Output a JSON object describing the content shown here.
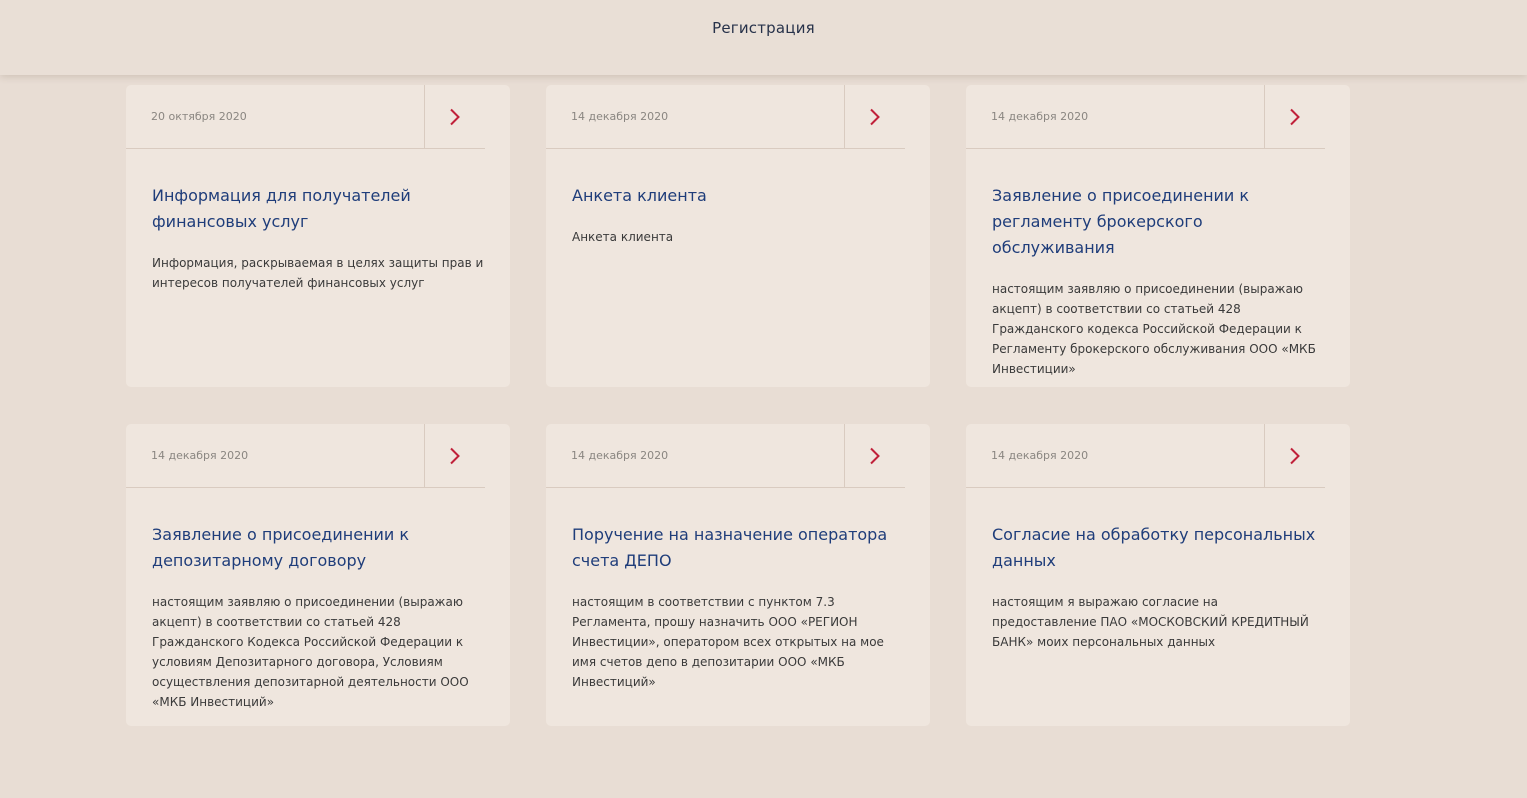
{
  "header": {
    "title": "Регистрация"
  },
  "cards": [
    {
      "date": "20 октября 2020",
      "title": "Информация для получателей финансовых услуг",
      "description": "Информация, раскрываемая в целях защиты прав и интересов получателей финансовых услуг"
    },
    {
      "date": "14 декабря 2020",
      "title": "Анкета клиента",
      "description": "Анкета клиента"
    },
    {
      "date": "14 декабря 2020",
      "title": "Заявление о присоединении к регламенту брокерского обслуживания",
      "description": "настоящим заявляю о присоединении (выражаю акцепт) в соответствии со статьей 428 Гражданского кодекса Российской Федерации к Регламенту брокерского обслуживания ООО «МКБ Инвестиции»"
    },
    {
      "date": "14 декабря 2020",
      "title": "Заявление о присоединении к депозитарному договору",
      "description": "настоящим заявляю о присоединении (выражаю акцепт) в соответствии со статьей 428 Гражданского Кодекса Российской Федерации к условиям Депозитарного договора, Условиям осуществления депозитарной деятельности ООО «МКБ Инвестиций»"
    },
    {
      "date": "14 декабря 2020",
      "title": "Поручение на назначение оператора счета ДЕПО",
      "description": "настоящим в соответствии с пунктом 7.3 Регламента, прошу назначить ООО «РЕГИОН Инвестиции», оператором всех открытых на мое имя счетов депо в депозитарии ООО «МКБ Инвестиций»"
    },
    {
      "date": "14 декабря 2020",
      "title": "Согласие на обработку персональных данных",
      "description": "настоящим я выражаю согласие на предоставление ПАО «МОСКОВСКИЙ КРЕДИТНЫЙ БАНК» моих персональных данных"
    }
  ],
  "colors": {
    "accent_arrow": "#c0213a",
    "title_blue": "#1f3d7a",
    "page_bg": "#e8ddd4",
    "card_bg": "#efe6de"
  },
  "icons": {
    "card_arrow": "chevron-right-icon"
  }
}
